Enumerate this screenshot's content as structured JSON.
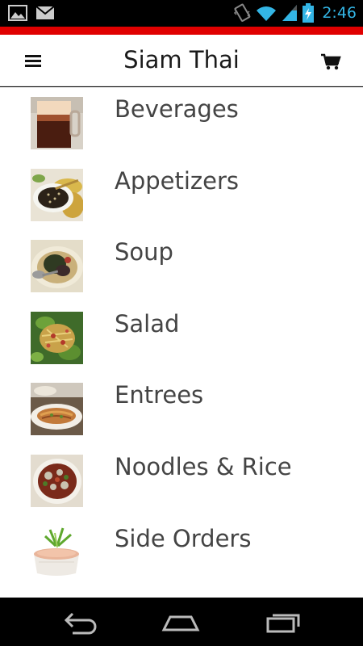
{
  "status_bar": {
    "time": "2:46",
    "icons": [
      "image-notification-icon",
      "gmail-notification-icon",
      "vibrate-icon",
      "wifi-icon",
      "signal-icon",
      "battery-charging-icon"
    ]
  },
  "app_bar": {
    "title": "Siam Thai",
    "menu_icon": "hamburger-menu-icon",
    "cart_icon": "shopping-cart-icon"
  },
  "categories": [
    {
      "label": "Beverages"
    },
    {
      "label": "Appetizers"
    },
    {
      "label": "Soup"
    },
    {
      "label": "Salad"
    },
    {
      "label": "Entrees"
    },
    {
      "label": "Noodles & Rice"
    },
    {
      "label": "Side Orders"
    }
  ],
  "nav_bar": {
    "icons": [
      "back-icon",
      "home-icon",
      "recent-apps-icon"
    ]
  },
  "colors": {
    "accent": "#e00000",
    "status_icons": "#33b5e5",
    "label_text": "#444444"
  }
}
